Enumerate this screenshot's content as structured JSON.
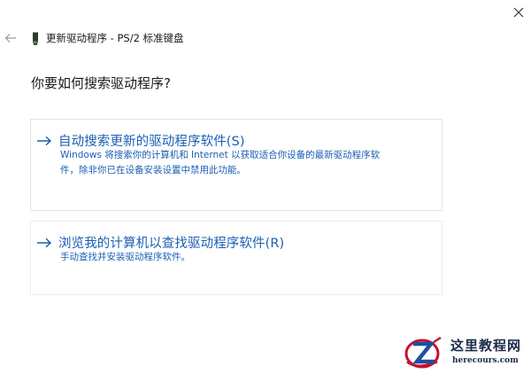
{
  "window": {
    "title": "更新驱动程序 - PS/2 标准键盘",
    "close_icon": "close-icon",
    "back_icon": "back-arrow-icon",
    "device_icon": "keyboard-device-icon"
  },
  "main": {
    "question": "你要如何搜索驱动程序?",
    "options": [
      {
        "title": "自动搜索更新的驱动程序软件(S)",
        "description_lines": [
          "Windows 将搜索你的计算机和 Internet 以获取适合你设备的最新驱动程序软",
          "件，除非你已在设备安装设置中禁用此功能。"
        ],
        "icon": "right-arrow-icon"
      },
      {
        "title": "浏览我的计算机以查找驱动程序软件(R)",
        "description_lines": [
          "手动查找并安装驱动程序软件。"
        ],
        "icon": "right-arrow-icon"
      }
    ]
  },
  "watermark": {
    "name": "这里教程网",
    "url": "herecours.com"
  },
  "colors": {
    "accent": "#1a5fb4",
    "text": "#1a1a1a",
    "option_border": "#d9e6f2",
    "watermark_red": "#c8102e",
    "watermark_blue": "#1c4f9c"
  }
}
